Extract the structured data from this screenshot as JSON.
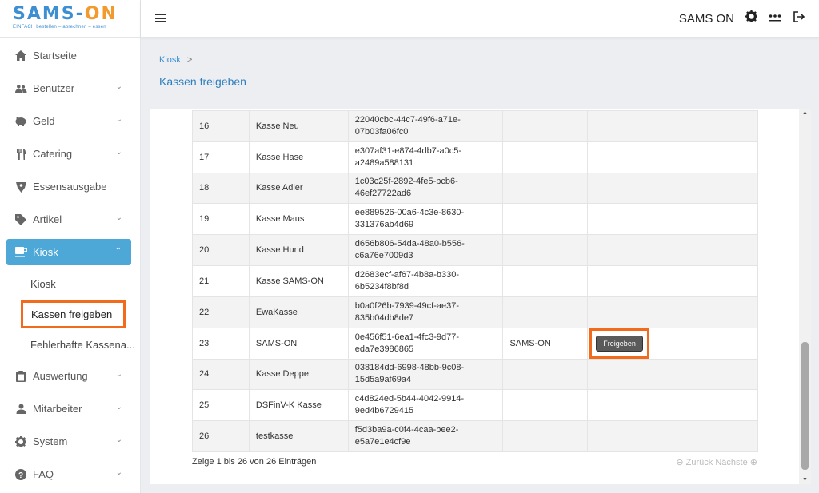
{
  "brand": {
    "logo_text_a": "SAMS-",
    "logo_text_b": "ON",
    "tagline": "EINFACH bestellen – abrechnen – essen",
    "accent": "#4da8d8",
    "highlight": "#f26a1b"
  },
  "topbar": {
    "user": "SAMS ON",
    "icons": [
      "hamburger-icon",
      "gear-icon",
      "dots-icon",
      "logout-icon"
    ]
  },
  "sidebar": {
    "items": [
      {
        "label": "Startseite",
        "icon": "home-icon"
      },
      {
        "label": "Benutzer",
        "icon": "users-icon"
      },
      {
        "label": "Geld",
        "icon": "piggy-bank-icon"
      },
      {
        "label": "Catering",
        "icon": "cutlery-icon"
      },
      {
        "label": "Essensausgabe",
        "icon": "award-icon"
      },
      {
        "label": "Artikel",
        "icon": "tag-icon"
      },
      {
        "label": "Kiosk",
        "icon": "coffee-icon"
      },
      {
        "label": "Auswertung",
        "icon": "clipboard-icon"
      },
      {
        "label": "Mitarbeiter",
        "icon": "person-icon"
      },
      {
        "label": "System",
        "icon": "gear-icon"
      },
      {
        "label": "FAQ",
        "icon": "question-icon"
      }
    ],
    "kiosk_sub": [
      "Kiosk",
      "Kassen freigeben",
      "Fehlerhafte Kassena..."
    ]
  },
  "header": {
    "breadcrumb": "Kiosk",
    "title": "Kassen freigeben"
  },
  "table": {
    "rows": [
      {
        "id": "16",
        "name": "Kasse Neu",
        "uuid1": "22040cbc-44c7-49f6-a71e-",
        "uuid2": "07b03fa06fc0",
        "owner": "",
        "action": ""
      },
      {
        "id": "17",
        "name": "Kasse Hase",
        "uuid1": "e307af31-e874-4db7-a0c5-",
        "uuid2": "a2489a588131",
        "owner": "",
        "action": ""
      },
      {
        "id": "18",
        "name": "Kasse Adler",
        "uuid1": "1c03c25f-2892-4fe5-bcb6-",
        "uuid2": "46ef27722ad6",
        "owner": "",
        "action": ""
      },
      {
        "id": "19",
        "name": "Kasse Maus",
        "uuid1": "ee889526-00a6-4c3e-8630-",
        "uuid2": "331376ab4d69",
        "owner": "",
        "action": ""
      },
      {
        "id": "20",
        "name": "Kasse Hund",
        "uuid1": "d656b806-54da-48a0-b556-",
        "uuid2": "c6a76e7009d3",
        "owner": "",
        "action": ""
      },
      {
        "id": "21",
        "name": "Kasse SAMS-ON",
        "uuid1": "d2683ecf-af67-4b8a-b330-",
        "uuid2": "6b5234f8bf8d",
        "owner": "",
        "action": ""
      },
      {
        "id": "22",
        "name": "EwaKasse",
        "uuid1": "b0a0f26b-7939-49cf-ae37-",
        "uuid2": "835b04db8de7",
        "owner": "",
        "action": ""
      },
      {
        "id": "23",
        "name": "SAMS-ON",
        "uuid1": "0e456f51-6ea1-4fc3-9d77-",
        "uuid2": "eda7e3986865",
        "owner": "SAMS-ON",
        "action": "Freigeben"
      },
      {
        "id": "24",
        "name": "Kasse Deppe",
        "uuid1": "038184dd-6998-48bb-9c08-",
        "uuid2": "15d5a9af69a4",
        "owner": "",
        "action": ""
      },
      {
        "id": "25",
        "name": "DSFinV-K Kasse",
        "uuid1": "c4d824ed-5b44-4042-9914-",
        "uuid2": "9ed4b6729415",
        "owner": "",
        "action": ""
      },
      {
        "id": "26",
        "name": "testkasse",
        "uuid1": "f5d3ba9a-c0f4-4caa-bee2-",
        "uuid2": "e5a7e1e4cf9e",
        "owner": "",
        "action": ""
      }
    ]
  },
  "footer": {
    "info": "Zeige 1 bis 26 von 26 Einträgen",
    "prev": "⊖ Zurück",
    "next": "Nächste ⊕"
  }
}
